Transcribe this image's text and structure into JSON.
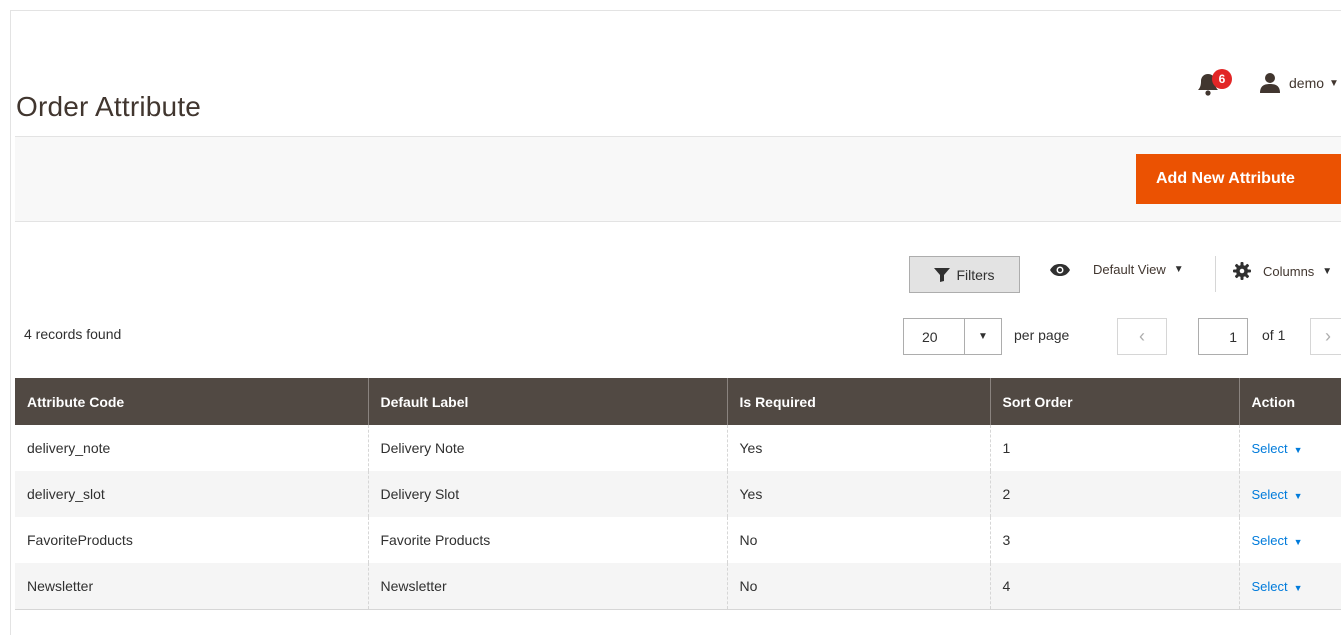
{
  "page": {
    "title": "Order Attribute"
  },
  "header": {
    "notifications_count": "6",
    "user_name": "demo"
  },
  "actions": {
    "add_new": "Add New Attribute"
  },
  "toolbar": {
    "filters": "Filters",
    "view": "Default View",
    "columns": "Columns",
    "records_found": "4 records found",
    "per_page_value": "20",
    "per_page_label": "per page",
    "current_page": "1",
    "total_pages": "of 1"
  },
  "table": {
    "columns": [
      "Attribute Code",
      "Default Label",
      "Is Required",
      "Sort Order",
      "Action"
    ],
    "rows": [
      {
        "code": "delivery_note",
        "label": "Delivery Note",
        "required": "Yes",
        "sort": "1",
        "action": "Select"
      },
      {
        "code": "delivery_slot",
        "label": "Delivery Slot",
        "required": "Yes",
        "sort": "2",
        "action": "Select"
      },
      {
        "code": "FavoriteProducts",
        "label": "Favorite Products",
        "required": "No",
        "sort": "3",
        "action": "Select"
      },
      {
        "code": "Newsletter",
        "label": "Newsletter",
        "required": "No",
        "sort": "4",
        "action": "Select"
      }
    ]
  },
  "icons": {
    "bell": "bell-icon",
    "user": "user-icon",
    "filter": "funnel-icon",
    "eye": "eye-icon",
    "gear": "gear-icon",
    "chevron_left": "chevron-left-icon",
    "chevron_right": "chevron-right-icon"
  },
  "colors": {
    "accent": "#eb5202",
    "header_bg": "#514943",
    "link": "#007bdb",
    "badge": "#e22626"
  }
}
